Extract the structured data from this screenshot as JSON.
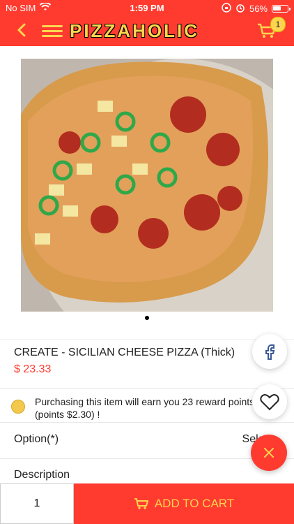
{
  "status_bar": {
    "carrier": "No SIM",
    "time": "1:59 PM",
    "battery": "56%",
    "battery_fill": 0.56
  },
  "header": {
    "logo_text": "PIZZAHOLIC",
    "cart_count": "1",
    "colors": {
      "bg": "#ff3b30",
      "accent": "#ffd54f"
    }
  },
  "product": {
    "name": "CREATE - SICILIAN CHEESE PIZZA (Thick)",
    "price": "$ 23.33",
    "reward_text": "Purchasing this item will earn you 23 reward points (points $2.30) !"
  },
  "options": {
    "label": "Option(*)",
    "select_text": "Select"
  },
  "description": {
    "label": "Description"
  },
  "bottom_bar": {
    "quantity": "1",
    "add_to_cart_label": "ADD TO CART"
  }
}
